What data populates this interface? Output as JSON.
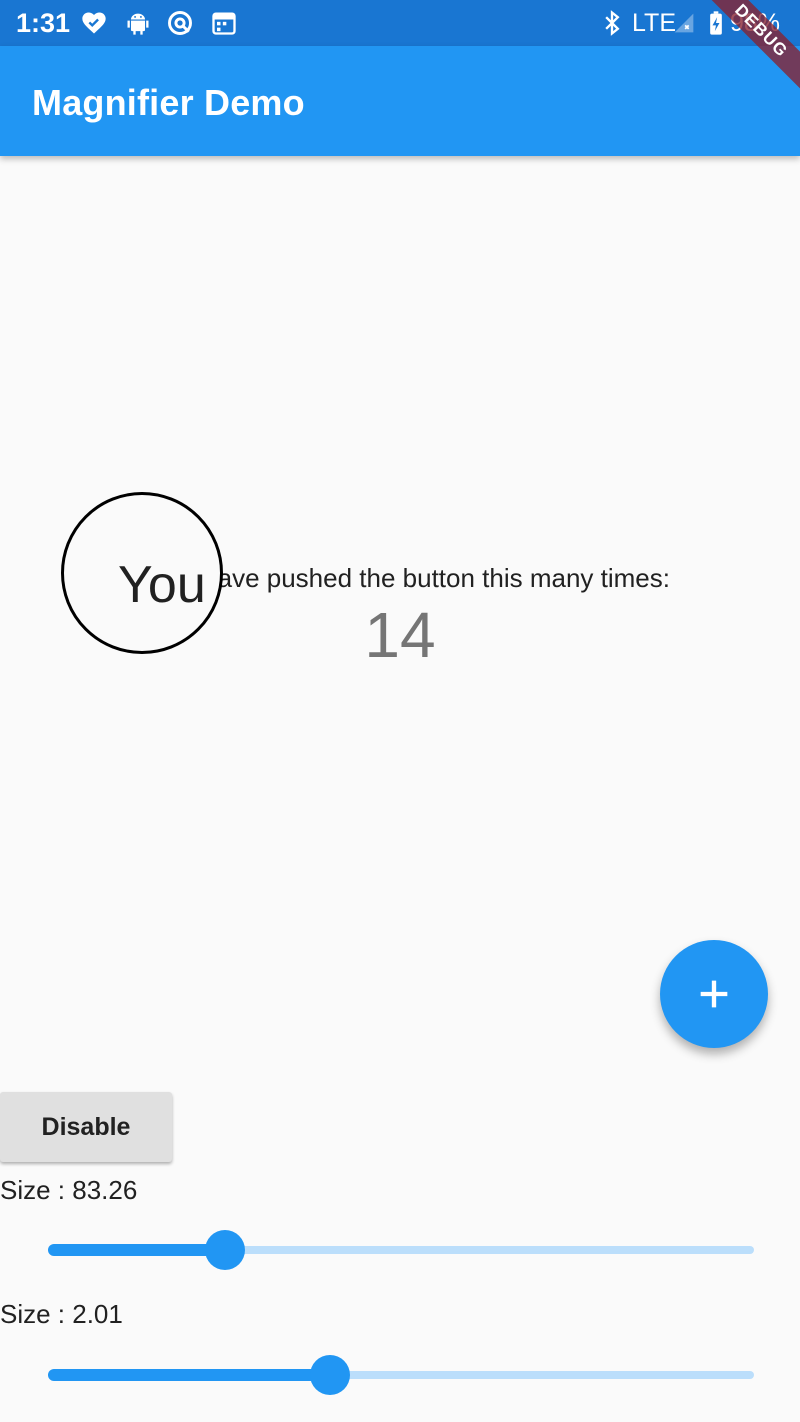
{
  "status_bar": {
    "time": "1:31",
    "network": "LTE",
    "battery": "98%",
    "icons_left": [
      "heart-check-icon",
      "android-icon",
      "vpn-icon",
      "calendar-icon"
    ],
    "icons_right": [
      "bluetooth-icon",
      "signal-icon",
      "battery-charging-icon"
    ]
  },
  "debug_banner": "DEBUG",
  "app_bar": {
    "title": "Magnifier Demo"
  },
  "counter": {
    "label": "You have pushed the button this many times:",
    "value": "14"
  },
  "magnifier": {
    "text": "You"
  },
  "fab": {
    "icon": "add-icon"
  },
  "disable_button": {
    "label": "Disable"
  },
  "sliders": [
    {
      "label": "Size : 83.26",
      "value_fraction": 0.25
    },
    {
      "label": "Size : 2.01",
      "value_fraction": 0.4
    }
  ],
  "colors": {
    "status_bar": "#1976d2",
    "app_bar": "#2196f3",
    "accent": "#2196f3",
    "track_inactive": "#bbdefb",
    "background": "#fafafa"
  }
}
